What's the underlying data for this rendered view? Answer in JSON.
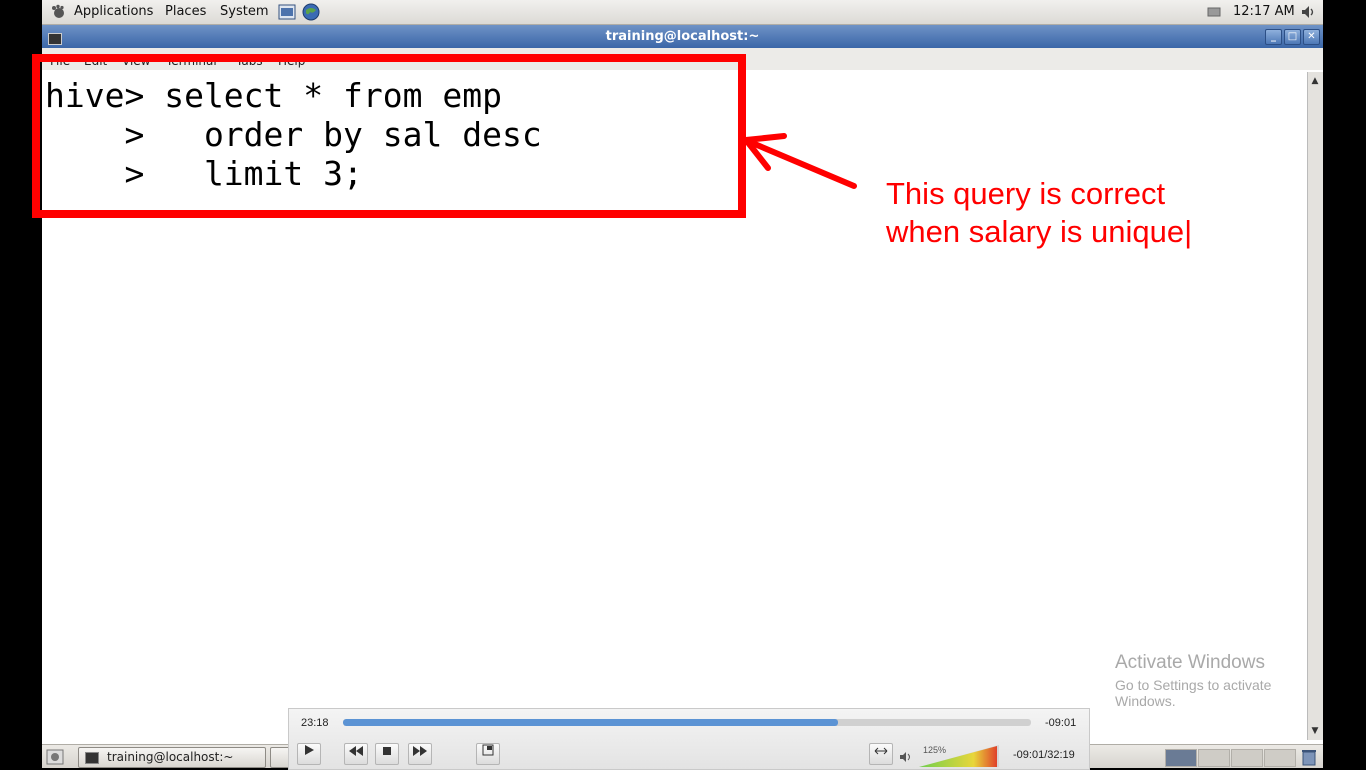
{
  "top_panel": {
    "applications": "Applications",
    "places": "Places",
    "system": "System",
    "clock": "12:17 AM"
  },
  "window": {
    "title": "training@localhost:~",
    "menu": [
      "File",
      "Edit",
      "View",
      "Terminal",
      "Tabs",
      "Help"
    ]
  },
  "terminal": {
    "lines": [
      "hive> select * from emp",
      "    >   order by sal desc",
      "    >   limit 3;"
    ]
  },
  "annotation": {
    "line1": "This query is correct",
    "line2": "when salary is unique|",
    "color": "#ff0000"
  },
  "watermark": {
    "title": "Activate Windows",
    "subtitle": "Go to Settings to activate Windows."
  },
  "taskbar": {
    "task1": "training@localhost:~"
  },
  "player": {
    "elapsed": "23:18",
    "remaining": "-09:01",
    "progress_fraction": 0.72,
    "zoom": "125%",
    "time_total": "-09:01/32:19",
    "accent": "#5b93d4"
  }
}
